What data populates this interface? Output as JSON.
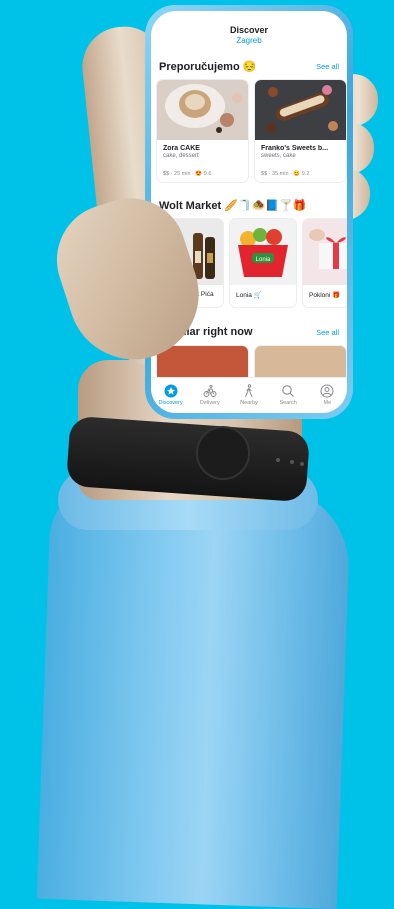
{
  "header": {
    "title": "Discover",
    "city": "Zagreb"
  },
  "recommended": {
    "title": "Preporučujemo 😔",
    "see_all": "See all",
    "cards": [
      {
        "name": "Zora CAKE",
        "sub": "cake, dessert",
        "meta": "$$ · 25 min · 😍 9.6"
      },
      {
        "name": "Franko's Sweets b...",
        "sub": "sweets, cake",
        "meta": "$$ · 35 min · 😊 9.2"
      }
    ]
  },
  "market": {
    "title": "Wolt Market 🥖🧻🧆📘🍸🎁",
    "cards": [
      {
        "name": "Sve to Svijet Pića"
      },
      {
        "name": "Lonia 🛒"
      },
      {
        "name": "Pokloni 🎁"
      }
    ]
  },
  "popular": {
    "title": "Popular right now",
    "see_all": "See all"
  },
  "nav": [
    {
      "label": "Discovery",
      "icon": "discovery-icon",
      "active": true
    },
    {
      "label": "Delivery",
      "icon": "bike-icon",
      "active": false
    },
    {
      "label": "Nearby",
      "icon": "walking-icon",
      "active": false
    },
    {
      "label": "Search",
      "icon": "search-icon",
      "active": false
    },
    {
      "label": "Me",
      "icon": "profile-icon",
      "active": false
    }
  ],
  "colors": {
    "background": "#00c2e8",
    "accent": "#009de0",
    "text": "#202125"
  }
}
